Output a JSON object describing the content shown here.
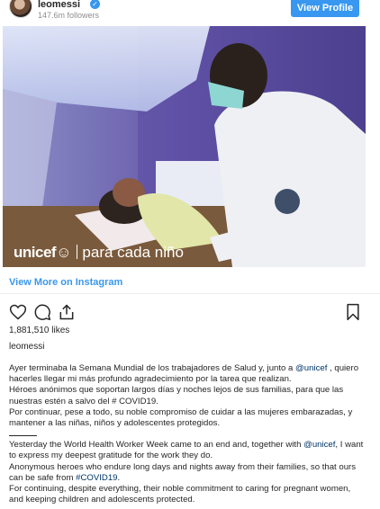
{
  "header": {
    "username": "leomessi",
    "followers": "147.6m followers",
    "view_profile": "View Profile",
    "verified_glyph": "✓"
  },
  "media": {
    "brand": "unicef",
    "brand_glyph": "☺",
    "tagline": "para cada niño"
  },
  "view_more": "View More on Instagram",
  "likes": "1,881,510 likes",
  "owner": "leomessi",
  "caption": {
    "es_1": "Ayer terminaba la Semana Mundial de los trabajadores de Salud y, junto a ",
    "es_mention": "@unicef",
    "es_2": " , quiero hacerles llegar mi más profundo agradecimiento por la tarea que realizan.",
    "es_3": "Héroes anónimos que soportan largos días y noches lejos de sus familias, para que las nuestras estén a salvo del # COVID19.",
    "es_4": "Por continuar, pese a todo, su noble compromiso de cuidar a las mujeres embarazadas, y mantener a las niñas, niños y adolescentes protegidos.",
    "en_1": "Yesterday the World Health Worker Week came to an end and, together with ",
    "en_mention": "@unicef",
    "en_2": ", I want to express my deepest gratitude for the work they do.",
    "en_3a": "Anonymous heroes who endure long days and nights away from their families, so that ours can be safe from ",
    "en_hashtag": "#COVID19",
    "en_3b": ".",
    "en_4": "For continuing, despite everything, their noble commitment to caring for pregnant women, and keeping children and adolescents protected."
  },
  "icons": [
    "heart-icon",
    "comment-icon",
    "share-icon",
    "bookmark-icon"
  ],
  "colors": {
    "accent": "#3897f0",
    "link": "#003569",
    "text": "#262626",
    "muted": "#8e8e8e"
  }
}
